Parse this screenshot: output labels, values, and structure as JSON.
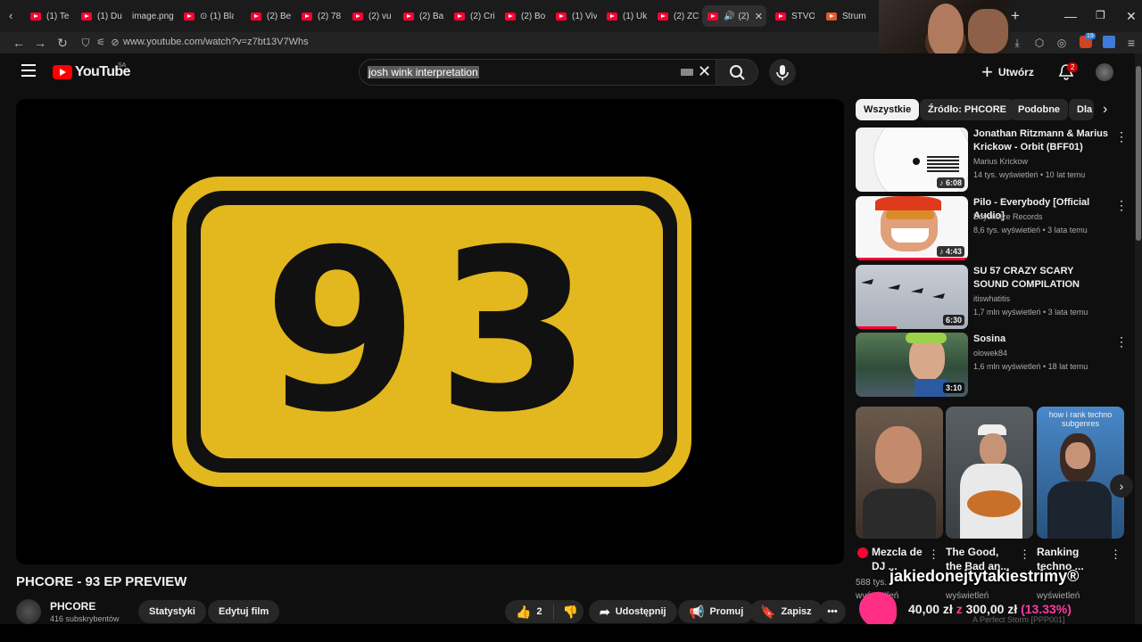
{
  "browser": {
    "tabs": [
      {
        "label": "(1) Te",
        "yt": true
      },
      {
        "label": "(1) Du",
        "yt": true
      },
      {
        "label": "image.png",
        "yt": false
      },
      {
        "label": "(1) Bla",
        "yt": true
      },
      {
        "label": "(2) Be",
        "yt": true
      },
      {
        "label": "(2) 78",
        "yt": true
      },
      {
        "label": "(2) vu",
        "yt": true
      },
      {
        "label": "(2) Ba",
        "yt": true
      },
      {
        "label": "(2) Cri",
        "yt": true
      },
      {
        "label": "(2) Bo",
        "yt": true
      },
      {
        "label": "(1) Viv",
        "yt": true
      },
      {
        "label": "(1) Uk",
        "yt": true
      },
      {
        "label": "(2) ZC",
        "yt": true
      },
      {
        "label": "(2)",
        "yt": true
      },
      {
        "label": "STVO",
        "yt": false
      },
      {
        "label": "Strum",
        "yt": false
      }
    ],
    "url": "www.youtube.com/watch?v=z7bt13V7Whs",
    "extension_badge": "19"
  },
  "header": {
    "logo": "YouTube",
    "country_code": "SA",
    "search_value": "josh wink interpretation",
    "create_label": "Utwórz",
    "notifications_count": "2"
  },
  "video": {
    "sign_number": "93",
    "title": "PHCORE - 93 EP PREVIEW",
    "channel": "PHCORE",
    "subscribers": "416 subskrybentów",
    "stats_label": "Statystyki",
    "edit_label": "Edytuj film",
    "likes": "2",
    "share_label": "Udostępnij",
    "promote_label": "Promuj",
    "save_label": "Zapisz"
  },
  "sidebar": {
    "chips": [
      "Wszystkie",
      "Źródło: PHCORE",
      "Podobne",
      "Dla"
    ],
    "recommendations": [
      {
        "title": "Jonathan Ritzmann & Marius Krickow - Orbit (BFF01)",
        "channel": "Marius Krickow",
        "meta": "14 tys. wyświetleń • 10 lat temu",
        "duration": "♪ 6:08"
      },
      {
        "title": "Pilo - Everybody [Official Audio]",
        "channel": "Boysnoize Records",
        "meta": "8,6 tys. wyświetleń • 3 lata temu",
        "duration": "♪ 4:43"
      },
      {
        "title": "SU 57 CRAZY SCARY SOUND COMPILATION",
        "channel": "itiswhatitis",
        "meta": "1,7 mln wyświetleń • 3 lata temu",
        "duration": "6:30"
      },
      {
        "title": "Sosina",
        "channel": "olowek84",
        "meta": "1,6 mln wyświetleń • 18 lat temu",
        "duration": "3:10"
      }
    ],
    "shorts": [
      {
        "title": "Mezcla de DJ ...",
        "meta1": "588 tys.",
        "meta2": "wyświetleń"
      },
      {
        "title": "The Good, the Bad an...",
        "meta1": "",
        "meta2": "wyświetleń"
      },
      {
        "title": "Ranking techno ...",
        "meta1": "",
        "meta2": "wyświetleń",
        "overlay": "how i rank techno subgenres"
      }
    ],
    "partial_text": "A Perfect Storm [PPP001]"
  },
  "stream_overlay": {
    "text": "jakiedonejtytakiestrimy®",
    "donation_current": "40,00 zł",
    "donation_sep": "z",
    "donation_goal": "300,00 zł",
    "donation_pct": "(13.33%)"
  },
  "colors": {
    "sign_yellow": "#e3b81f",
    "youtube_red": "#ff0000",
    "overlay_pink": "#ff2f86"
  }
}
